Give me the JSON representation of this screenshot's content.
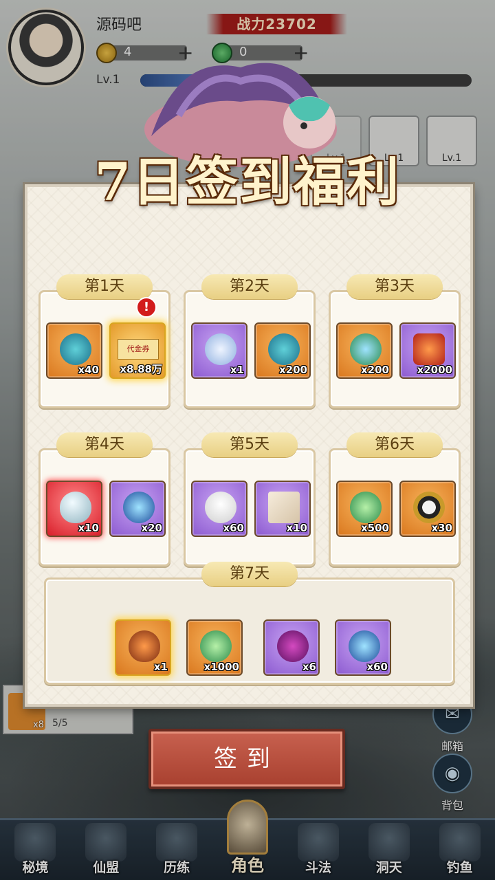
{
  "player": {
    "name": "源码吧",
    "power_label": "战力23702",
    "gold": "4",
    "jade": "0",
    "level": "Lv.1"
  },
  "slots": [
    {
      "label": "Lv.1"
    },
    {
      "label": "Lv.1"
    },
    {
      "label": "Lv.1"
    }
  ],
  "side_buttons": {
    "mail": "邮箱",
    "bag": "背包"
  },
  "quest": {
    "qty": "x8",
    "progress": "5/5"
  },
  "popup": {
    "title": "7日签到福利",
    "days": [
      {
        "label": "第1天",
        "items": [
          {
            "qty": "x40"
          },
          {
            "qty": "x8.88万"
          }
        ]
      },
      {
        "label": "第2天",
        "items": [
          {
            "qty": "x1"
          },
          {
            "qty": "x200"
          }
        ]
      },
      {
        "label": "第3天",
        "items": [
          {
            "qty": "x200"
          },
          {
            "qty": "x2000"
          }
        ]
      },
      {
        "label": "第4天",
        "items": [
          {
            "qty": "x10"
          },
          {
            "qty": "x20"
          }
        ]
      },
      {
        "label": "第5天",
        "items": [
          {
            "qty": "x60"
          },
          {
            "qty": "x10"
          }
        ]
      },
      {
        "label": "第6天",
        "items": [
          {
            "qty": "x500"
          },
          {
            "qty": "x30"
          }
        ]
      },
      {
        "label": "第7天",
        "items": [
          {
            "qty": "x1"
          },
          {
            "qty": "x1000"
          },
          {
            "qty": "x6"
          },
          {
            "qty": "x60"
          }
        ]
      }
    ],
    "voucher_text": "代金券",
    "alert_mark": "!",
    "sign_button": "签到"
  },
  "nav": [
    {
      "label": "秘境"
    },
    {
      "label": "仙盟"
    },
    {
      "label": "历练"
    },
    {
      "label": "角色"
    },
    {
      "label": "斗法"
    },
    {
      "label": "洞天"
    },
    {
      "label": "钓鱼"
    }
  ],
  "colors": {
    "accent_gold": "#e8cf83",
    "sign_red": "#a8402f",
    "item_orange": "#d9771e",
    "item_purple": "#8c5ad0"
  }
}
